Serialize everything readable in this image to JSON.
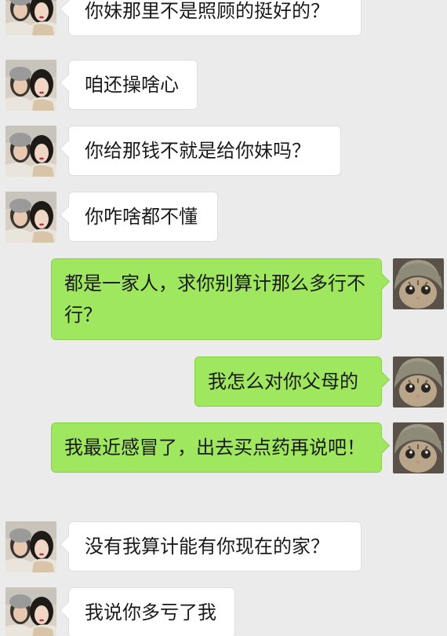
{
  "chat": {
    "messages": [
      {
        "side": "in",
        "avatar": "contact-avatar",
        "text": "你妹那里不是照顾的挺好的？"
      },
      {
        "side": "in",
        "avatar": "contact-avatar",
        "text": "咱还操啥心"
      },
      {
        "side": "in",
        "avatar": "contact-avatar",
        "text": "你给那钱不就是给你妹吗？"
      },
      {
        "side": "in",
        "avatar": "contact-avatar",
        "text": "你咋啥都不懂"
      },
      {
        "side": "out",
        "avatar": "cat-avatar",
        "text": "都是一家人，求你别算计那么多行不行？"
      },
      {
        "side": "out",
        "avatar": "cat-avatar",
        "text": "我怎么对你父母的"
      },
      {
        "side": "out",
        "avatar": "cat-avatar",
        "text": "我最近感冒了，出去买点药再说吧！"
      },
      {
        "side": "in",
        "avatar": "contact-avatar",
        "text": "没有我算计能有你现在的家？"
      },
      {
        "side": "in",
        "avatar": "contact-avatar",
        "text": "我说你多亏了我"
      }
    ]
  },
  "colors": {
    "background": "#ebebeb",
    "incoming_bubble": "#ffffff",
    "outgoing_bubble": "#9fe75e"
  }
}
